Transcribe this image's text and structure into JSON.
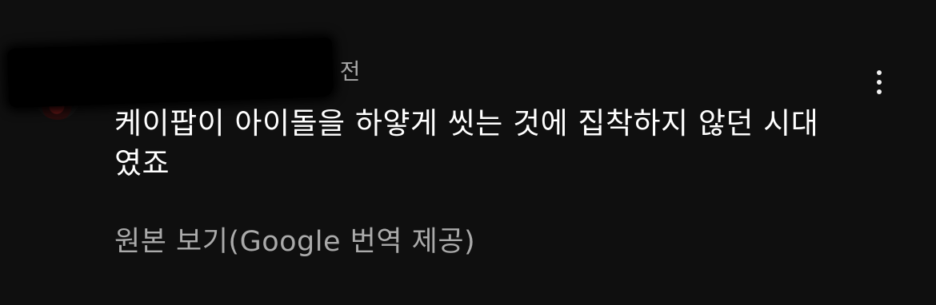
{
  "comment": {
    "author": "",
    "timestamp": "주 전",
    "text_line1": "케이팝이 아이돌을 하얗게 씻는 것에 집착하지 않던 시대",
    "text_line2": "였죠",
    "translation_link": "원본 보기(Google 번역 제공)"
  },
  "ui": {
    "more_menu": "more-vertical-icon",
    "redaction_color": "#000000",
    "background": "#0f0f0f"
  }
}
